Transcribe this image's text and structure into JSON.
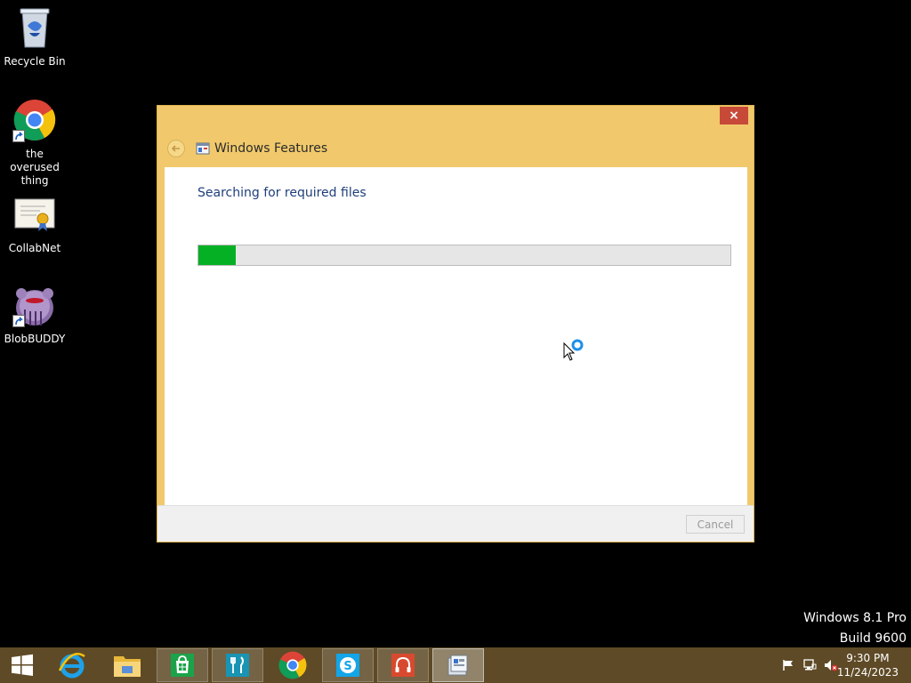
{
  "desktop": {
    "icons": [
      {
        "label": "Recycle Bin",
        "icon": "recycle-bin-icon"
      },
      {
        "label": "the overused thing",
        "icon": "chrome-icon"
      },
      {
        "label": "CollabNet",
        "icon": "certificate-icon"
      },
      {
        "label": "BlobBUDDY",
        "icon": "blob-creature-icon"
      }
    ]
  },
  "dialog": {
    "title": "Windows Features",
    "close_label": "×",
    "status": "Searching for required files",
    "progress_percent": 7,
    "cancel_label": "Cancel",
    "accent_color": "#f1c96c",
    "progress_color": "#06b025"
  },
  "watermark": {
    "line1": "Windows 8.1 Pro",
    "line2": "Build 9600"
  },
  "taskbar": {
    "buttons": [
      {
        "name": "internet-explorer",
        "icon": "ie-icon"
      },
      {
        "name": "file-explorer",
        "icon": "folder-icon"
      },
      {
        "name": "store",
        "icon": "store-icon"
      },
      {
        "name": "food-drink",
        "icon": "fork-knife-icon"
      },
      {
        "name": "chrome",
        "icon": "chrome-icon"
      },
      {
        "name": "skype",
        "icon": "skype-icon"
      },
      {
        "name": "music",
        "icon": "headphones-icon"
      },
      {
        "name": "windows-features",
        "icon": "windows-features-icon"
      }
    ],
    "clock": {
      "time": "9:30 PM",
      "date": "11/24/2023"
    }
  }
}
